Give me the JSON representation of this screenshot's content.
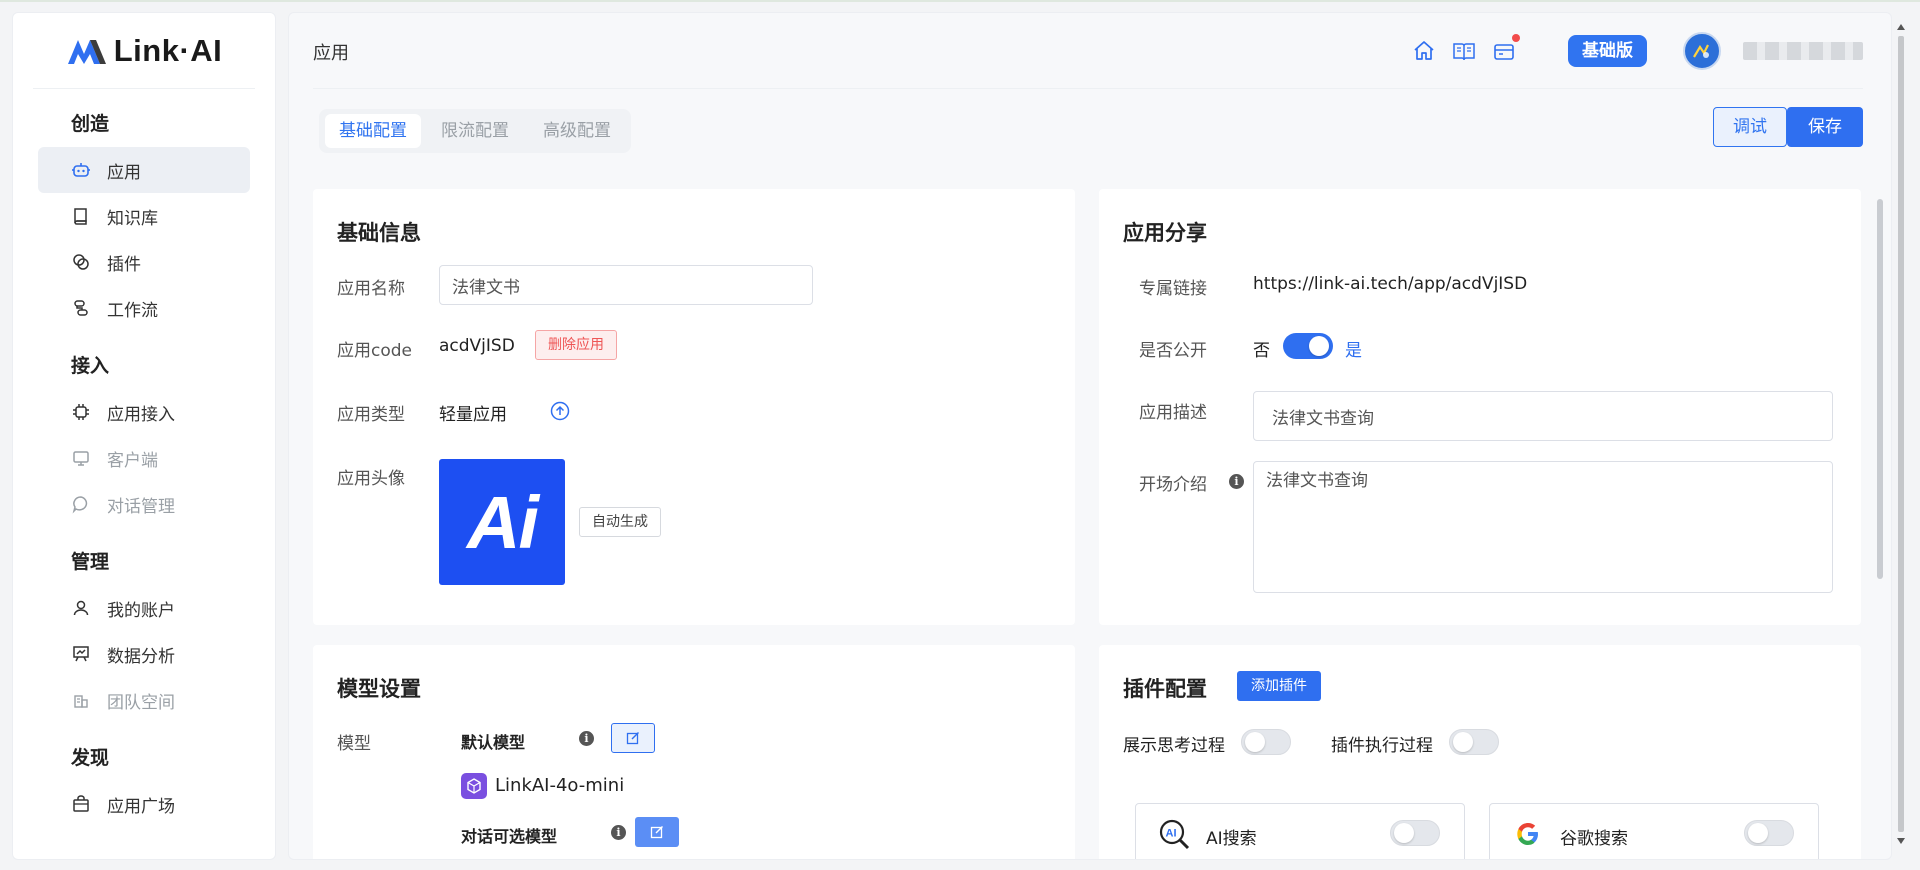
{
  "brand": {
    "logo_text": "Link·AI"
  },
  "sidebar": {
    "sections": [
      {
        "title": "创造",
        "items": [
          {
            "label": "应用",
            "icon": "robot-icon",
            "active": true
          },
          {
            "label": "知识库",
            "icon": "book-icon"
          },
          {
            "label": "插件",
            "icon": "plugin-icon"
          },
          {
            "label": "工作流",
            "icon": "workflow-icon"
          }
        ]
      },
      {
        "title": "接入",
        "items": [
          {
            "label": "应用接入",
            "icon": "chip-icon"
          },
          {
            "label": "客户端",
            "icon": "monitor-icon",
            "disabled": true
          },
          {
            "label": "对话管理",
            "icon": "chat-icon",
            "disabled": true
          }
        ]
      },
      {
        "title": "管理",
        "items": [
          {
            "label": "我的账户",
            "icon": "user-icon"
          },
          {
            "label": "数据分析",
            "icon": "chart-icon"
          },
          {
            "label": "团队空间",
            "icon": "building-icon",
            "disabled": true
          }
        ]
      },
      {
        "title": "发现",
        "items": [
          {
            "label": "应用广场",
            "icon": "store-icon"
          }
        ]
      }
    ]
  },
  "header": {
    "title": "应用",
    "plan_badge": "基础版"
  },
  "tabs": [
    "基础配置",
    "限流配置",
    "高级配置"
  ],
  "actions": {
    "debug": "调试",
    "save": "保存"
  },
  "basic_info": {
    "title": "基础信息",
    "name_label": "应用名称",
    "name_value": "法律文书",
    "code_label": "应用code",
    "code_value": "acdVjISD",
    "delete_label": "删除应用",
    "type_label": "应用类型",
    "type_value": "轻量应用",
    "avatar_label": "应用头像",
    "avatar_text": "Ai",
    "auto_generate": "自动生成"
  },
  "share": {
    "title": "应用分享",
    "link_label": "专属链接",
    "link_value": "https://link-ai.tech/app/acdVjISD",
    "public_label": "是否公开",
    "public_no": "否",
    "public_yes": "是",
    "is_public": true,
    "desc_label": "应用描述",
    "desc_value": "法律文书查询",
    "intro_label": "开场介绍",
    "intro_value": "法律文书查询"
  },
  "model": {
    "title": "模型设置",
    "model_label": "模型",
    "default_model_label": "默认模型",
    "default_model_name": "LinkAI-4o-mini",
    "optional_models_label": "对话可选模型"
  },
  "plugins": {
    "title": "插件配置",
    "add_label": "添加插件",
    "show_thinking_label": "展示思考过程",
    "show_exec_label": "插件执行过程",
    "items": [
      {
        "name": "AI搜索",
        "icon": "ai-search-icon",
        "enabled": false
      },
      {
        "name": "谷歌搜索",
        "icon": "google-icon",
        "enabled": false
      }
    ]
  },
  "colors": {
    "accent": "#2f6ff0",
    "danger": "#ee5656"
  }
}
